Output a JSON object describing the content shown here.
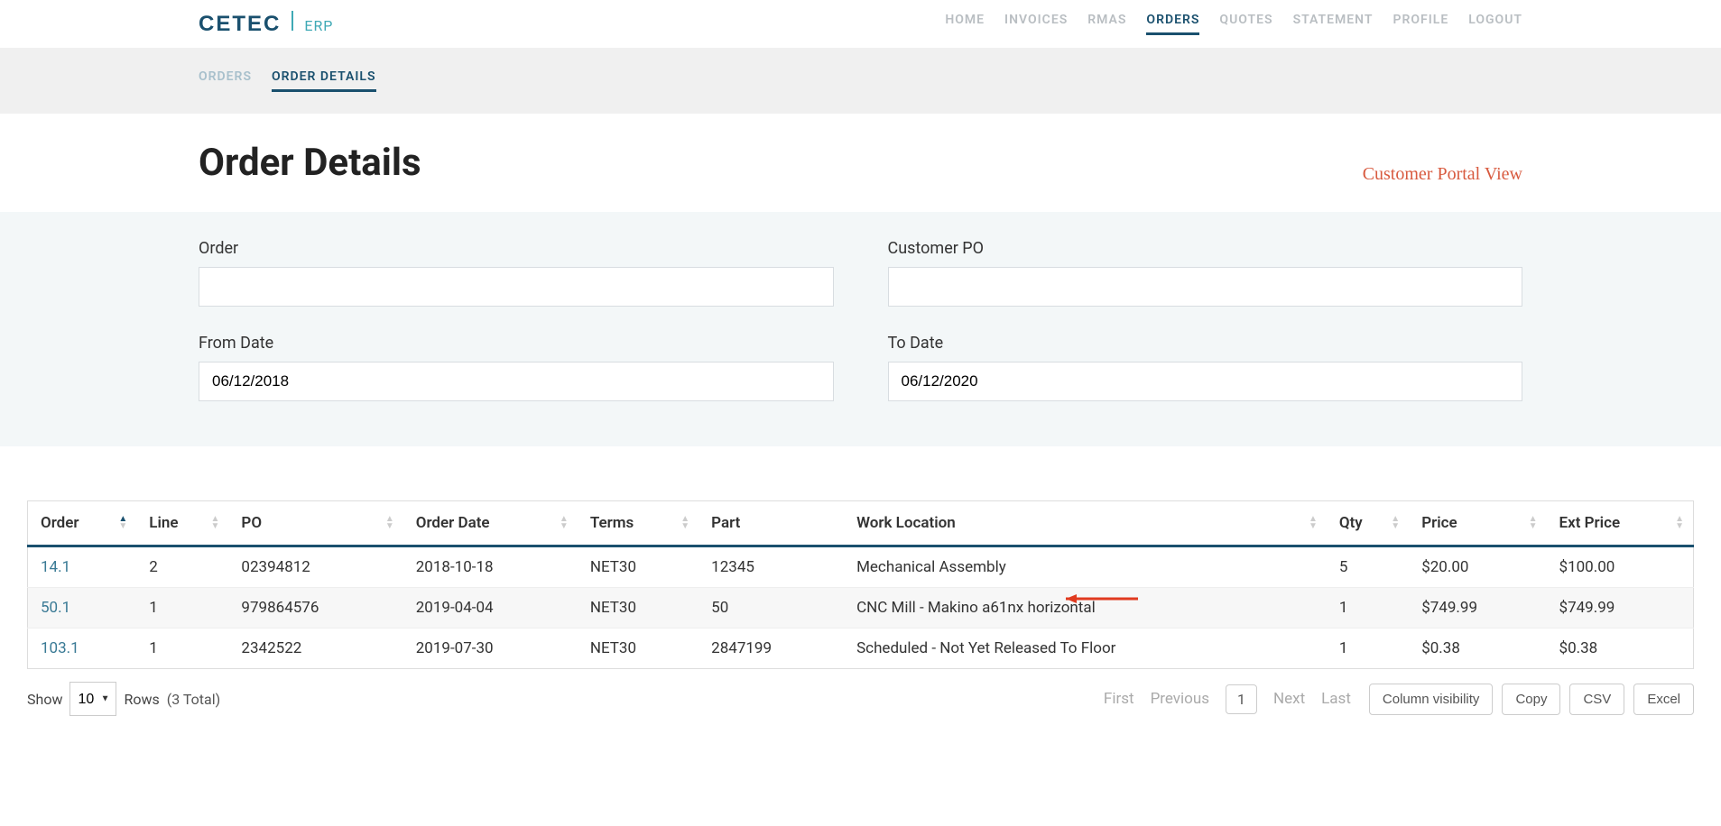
{
  "logo": {
    "main": "CETEC",
    "sub": "ERP"
  },
  "nav": {
    "items": [
      {
        "label": "HOME"
      },
      {
        "label": "INVOICES"
      },
      {
        "label": "RMAS"
      },
      {
        "label": "ORDERS",
        "active": true
      },
      {
        "label": "QUOTES"
      },
      {
        "label": "STATEMENT"
      },
      {
        "label": "PROFILE"
      },
      {
        "label": "LOGOUT"
      }
    ]
  },
  "subnav": {
    "items": [
      {
        "label": "ORDERS"
      },
      {
        "label": "ORDER DETAILS",
        "active": true
      }
    ]
  },
  "page": {
    "title": "Order Details",
    "portal_view": "Customer Portal View"
  },
  "filters": {
    "order": {
      "label": "Order",
      "value": ""
    },
    "customer_po": {
      "label": "Customer PO",
      "value": ""
    },
    "from_date": {
      "label": "From Date",
      "value": "06/12/2018"
    },
    "to_date": {
      "label": "To Date",
      "value": "06/12/2020"
    }
  },
  "table": {
    "columns": [
      "Order",
      "Line",
      "PO",
      "Order Date",
      "Terms",
      "Part",
      "Work Location",
      "Qty",
      "Price",
      "Ext Price"
    ],
    "rows": [
      {
        "order": "14.1",
        "line": "2",
        "po": "02394812",
        "date": "2018-10-18",
        "terms": "NET30",
        "part": "12345",
        "work": "Mechanical Assembly",
        "qty": "5",
        "price": "$20.00",
        "ext": "$100.00"
      },
      {
        "order": "50.1",
        "line": "1",
        "po": "979864576",
        "date": "2019-04-04",
        "terms": "NET30",
        "part": "50",
        "work": "CNC Mill - Makino a61nx horizontal",
        "qty": "1",
        "price": "$749.99",
        "ext": "$749.99",
        "annot": true
      },
      {
        "order": "103.1",
        "line": "1",
        "po": "2342522",
        "date": "2019-07-30",
        "terms": "NET30",
        "part": "2847199",
        "work": "Scheduled - Not Yet Released To Floor",
        "qty": "1",
        "price": "$0.38",
        "ext": "$0.38"
      }
    ]
  },
  "footer": {
    "show_label": "Show",
    "rows_label": "Rows",
    "rows_value": "10",
    "total_text": "(3 Total)",
    "pager": {
      "first": "First",
      "prev": "Previous",
      "current": "1",
      "next": "Next",
      "last": "Last"
    },
    "buttons": {
      "colvis": "Column visibility",
      "copy": "Copy",
      "csv": "CSV",
      "excel": "Excel"
    }
  }
}
